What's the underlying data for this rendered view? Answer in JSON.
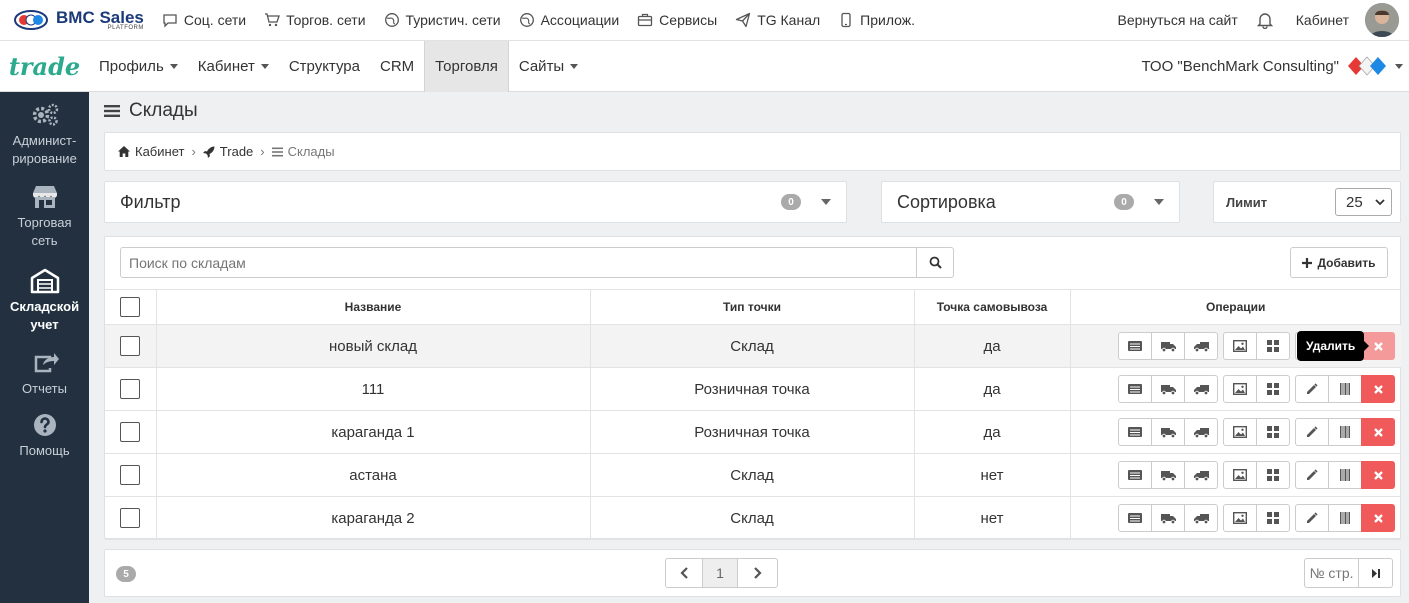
{
  "topbar": {
    "logo_title": "BMC Sales",
    "logo_sub": "PLATFORM",
    "links": [
      {
        "label": "Соц. сети",
        "icon": "chat-icon"
      },
      {
        "label": "Торгов. сети",
        "icon": "cart-icon"
      },
      {
        "label": "Туристич. сети",
        "icon": "globe-icon"
      },
      {
        "label": "Ассоциации",
        "icon": "globe-icon"
      },
      {
        "label": "Сервисы",
        "icon": "briefcase-icon"
      },
      {
        "label": "TG Канал",
        "icon": "send-icon"
      },
      {
        "label": "Прилож.",
        "icon": "phone-icon"
      }
    ],
    "back_to_site": "Вернуться на сайт",
    "cabinet": "Кабинет"
  },
  "navbar": {
    "brand": "trade",
    "items": [
      {
        "label": "Профиль",
        "dropdown": true
      },
      {
        "label": "Кабинет",
        "dropdown": true
      },
      {
        "label": "Структура",
        "dropdown": false
      },
      {
        "label": "CRM",
        "dropdown": false
      },
      {
        "label": "Торговля",
        "dropdown": false,
        "active": true
      },
      {
        "label": "Сайты",
        "dropdown": true
      }
    ],
    "company": "ТОО \"BenchMark Consulting\""
  },
  "sidebar": {
    "items": [
      {
        "label": "Админист-рирование",
        "icon": "gears-icon"
      },
      {
        "label": "Торговая сеть",
        "icon": "store-icon"
      },
      {
        "label": "Складской учет",
        "icon": "warehouse-icon",
        "active": true
      },
      {
        "label": "Отчеты",
        "icon": "share-icon"
      },
      {
        "label": "Помощь",
        "icon": "help-icon"
      }
    ]
  },
  "page": {
    "title": "Склады",
    "breadcrumb": [
      "Кабинет",
      "Trade",
      "Склады"
    ]
  },
  "filter": {
    "label": "Фильтр",
    "count": "0"
  },
  "sort": {
    "label": "Сортировка",
    "count": "0"
  },
  "limit": {
    "label": "Лимит",
    "value": "25"
  },
  "search": {
    "placeholder": "Поиск по складам"
  },
  "add_button": "Добавить",
  "table": {
    "headers": [
      "Название",
      "Тип точки",
      "Точка самовывоза",
      "Операции"
    ],
    "rows": [
      {
        "name": "новый склад",
        "type": "Склад",
        "pickup": "да"
      },
      {
        "name": "111",
        "type": "Розничная точка",
        "pickup": "да"
      },
      {
        "name": "караганда 1",
        "type": "Розничная точка",
        "pickup": "да"
      },
      {
        "name": "астана",
        "type": "Склад",
        "pickup": "нет"
      },
      {
        "name": "караганда 2",
        "type": "Склад",
        "pickup": "нет"
      }
    ]
  },
  "tooltip": "Удалить",
  "footer": {
    "total": "5",
    "current_page": "1",
    "page_no_label": "№ стр."
  },
  "colors": {
    "accent": "#2baa8e",
    "sidebar": "#22303f",
    "delete": "#f05a5b",
    "brand_blue": "#1b3a7a"
  }
}
